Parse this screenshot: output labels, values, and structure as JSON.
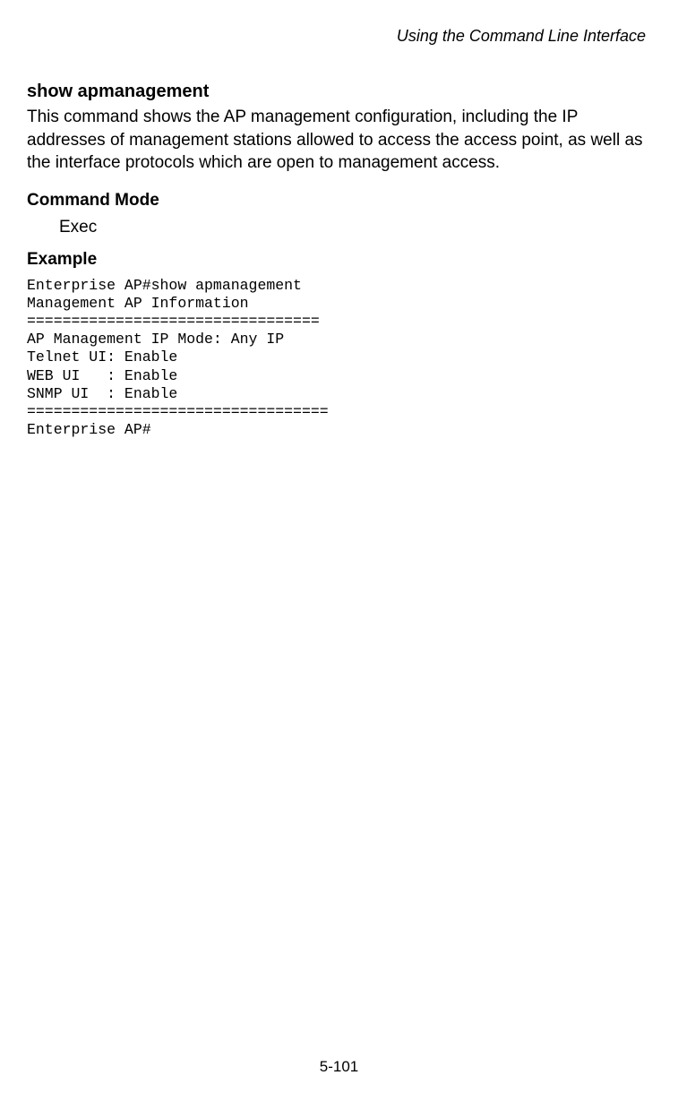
{
  "header": {
    "chapter_title": "Using the Command Line Interface"
  },
  "section": {
    "title": "show apmanagement",
    "description": "This command shows the AP management configuration, including the IP addresses of management stations allowed to access the access point, as well as the interface protocols which are open to management access."
  },
  "command_mode": {
    "label": "Command Mode",
    "value": "Exec"
  },
  "example": {
    "label": "Example",
    "content": "Enterprise AP#show apmanagement\nManagement AP Information\n=================================\nAP Management IP Mode: Any IP\nTelnet UI: Enable\nWEB UI   : Enable\nSNMP UI  : Enable\n==================================\nEnterprise AP#"
  },
  "footer": {
    "page_number": "5-101"
  }
}
